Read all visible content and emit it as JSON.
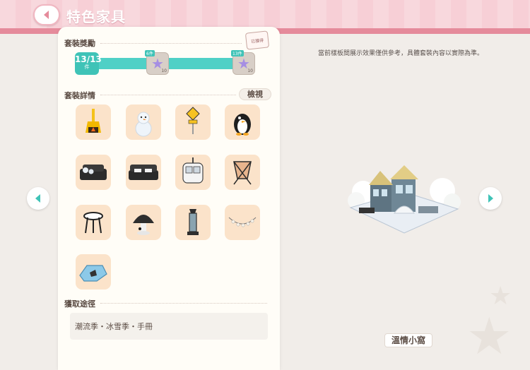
{
  "header": {
    "title": "特色家具",
    "back_icon": "chevron-left-icon"
  },
  "rewards": {
    "title": "套裝獎勵",
    "progress_current": 13,
    "progress_total": 13,
    "progress_text": "13/13",
    "progress_unit": "件",
    "stamp_text": "已獲得",
    "milestones": [
      {
        "tag": "6件",
        "icon": "purple-star-icon",
        "qty": "10"
      },
      {
        "tag": "13件",
        "icon": "purple-star-icon",
        "qty": "10"
      }
    ]
  },
  "details": {
    "title": "套裝詳情",
    "view_label": "檢視",
    "items": [
      {
        "name": "yellow-fireplace"
      },
      {
        "name": "snowman"
      },
      {
        "name": "road-sign"
      },
      {
        "name": "penguin"
      },
      {
        "name": "dark-sofa-small"
      },
      {
        "name": "dark-sofa-large"
      },
      {
        "name": "cable-car-cabin"
      },
      {
        "name": "butterfly-chair"
      },
      {
        "name": "round-side-table"
      },
      {
        "name": "mushroom-lamp"
      },
      {
        "name": "patio-heater"
      },
      {
        "name": "garland-lights"
      },
      {
        "name": "ice-rug"
      }
    ]
  },
  "acquire": {
    "title": "獲取途徑",
    "text": "潮流季・冰雪季・手冊"
  },
  "preview": {
    "notice": "當前樣板間展示效果僅供參考，具體套裝內容以實際為準。",
    "set_name": "溫情小窩",
    "prev_icon": "arrow-left-icon",
    "next_icon": "arrow-right-icon"
  },
  "colors": {
    "header_pink": "#f7cfd6",
    "accent_teal": "#3fc3b7",
    "item_bg": "#fbe3ca"
  }
}
